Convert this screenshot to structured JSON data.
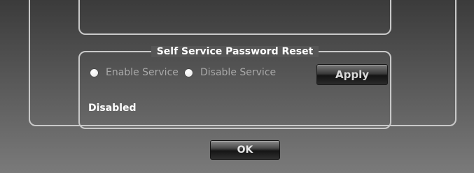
{
  "group": {
    "title": "Self Service Password Reset",
    "enable_label": "Enable Service",
    "disable_label": "Disable Service",
    "apply_label": "Apply",
    "status": "Disabled"
  },
  "footer": {
    "ok_label": "OK"
  }
}
